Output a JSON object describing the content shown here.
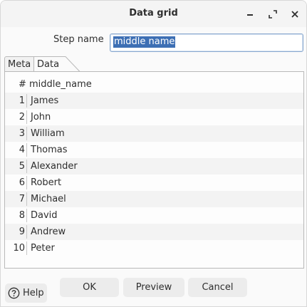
{
  "window": {
    "title": "Data grid"
  },
  "form": {
    "step_name_label": "Step name",
    "step_name_value": "middle name"
  },
  "tabs": [
    {
      "label": "Meta"
    },
    {
      "label": "Data"
    }
  ],
  "grid": {
    "headers": {
      "num": "#",
      "name": "middle_name"
    },
    "rows": [
      {
        "n": "1",
        "v": "James"
      },
      {
        "n": "2",
        "v": "John"
      },
      {
        "n": "3",
        "v": "William"
      },
      {
        "n": "4",
        "v": "Thomas"
      },
      {
        "n": "5",
        "v": "Alexander"
      },
      {
        "n": "6",
        "v": "Robert"
      },
      {
        "n": "7",
        "v": "Michael"
      },
      {
        "n": "8",
        "v": "David"
      },
      {
        "n": "9",
        "v": "Andrew"
      },
      {
        "n": "10",
        "v": "Peter"
      }
    ]
  },
  "buttons": {
    "help": "Help",
    "ok": "OK",
    "preview": "Preview",
    "cancel": "Cancel"
  },
  "colors": {
    "selection": "#3d6fb4",
    "accent_border": "#8aa9cf"
  }
}
